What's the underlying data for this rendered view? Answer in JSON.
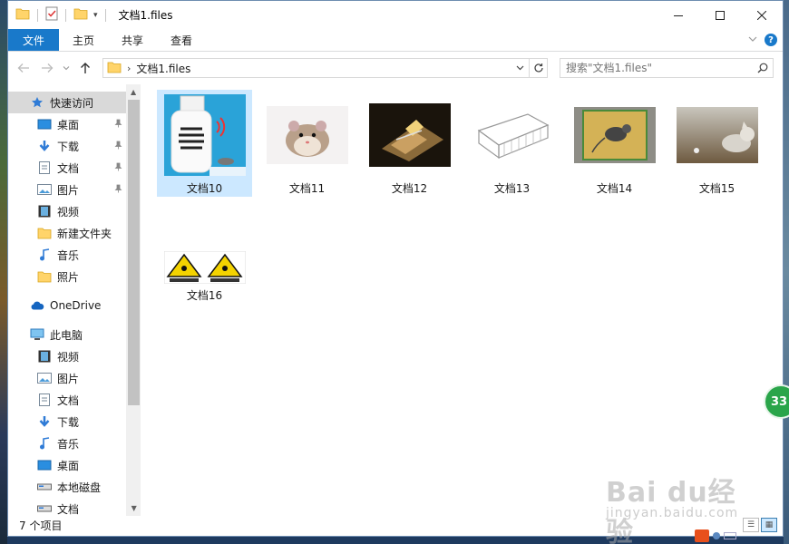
{
  "window": {
    "title": "文档1.files"
  },
  "ribbon": {
    "tabs": [
      "文件",
      "主页",
      "共享",
      "查看"
    ]
  },
  "address": {
    "segments": [
      "文档1.files"
    ]
  },
  "search": {
    "placeholder": "搜索\"文档1.files\""
  },
  "nav": {
    "quick_access": "快速访问",
    "quick_items": [
      {
        "label": "桌面",
        "icon": "desktop-icon",
        "pinned": true
      },
      {
        "label": "下载",
        "icon": "download-icon",
        "pinned": true
      },
      {
        "label": "文档",
        "icon": "document-icon",
        "pinned": true
      },
      {
        "label": "图片",
        "icon": "pictures-icon",
        "pinned": true
      },
      {
        "label": "视频",
        "icon": "video-icon",
        "pinned": false
      },
      {
        "label": "新建文件夹",
        "icon": "folder-icon",
        "pinned": false
      },
      {
        "label": "音乐",
        "icon": "music-icon",
        "pinned": false
      },
      {
        "label": "照片",
        "icon": "folder-icon",
        "pinned": false
      }
    ],
    "onedrive": "OneDrive",
    "this_pc": "此电脑",
    "pc_items": [
      {
        "label": "视频",
        "icon": "video-icon"
      },
      {
        "label": "图片",
        "icon": "pictures-icon"
      },
      {
        "label": "文档",
        "icon": "document-icon"
      },
      {
        "label": "下载",
        "icon": "download-icon"
      },
      {
        "label": "音乐",
        "icon": "music-icon"
      },
      {
        "label": "桌面",
        "icon": "desktop-icon"
      },
      {
        "label": "本地磁盘",
        "icon": "drive-icon"
      },
      {
        "label": "文档",
        "icon": "drive-icon"
      }
    ]
  },
  "files": [
    {
      "label": "文档10",
      "selected": true
    },
    {
      "label": "文档11",
      "selected": false
    },
    {
      "label": "文档12",
      "selected": false
    },
    {
      "label": "文档13",
      "selected": false
    },
    {
      "label": "文档14",
      "selected": false
    },
    {
      "label": "文档15",
      "selected": false
    },
    {
      "label": "文档16",
      "selected": false
    }
  ],
  "status": {
    "count": "7 个项目"
  },
  "overlay": {
    "badge": "33",
    "watermark": "Bai du经验",
    "watermark_url": "jingyan.baidu.com"
  },
  "colors": {
    "accent": "#1979ca",
    "selection": "#cce8ff",
    "badge": "#2aa54a"
  }
}
